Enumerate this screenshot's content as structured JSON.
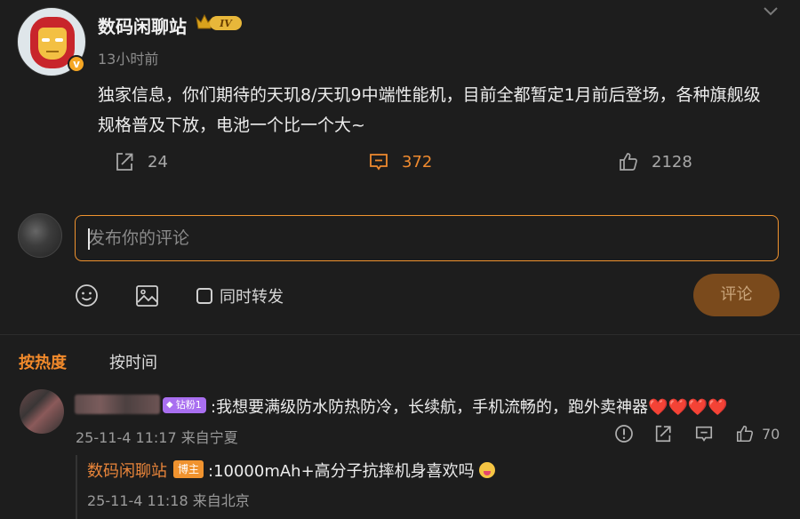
{
  "post": {
    "username": "数码闲聊站",
    "level_badge": "IV",
    "time": "13小时前",
    "text": "独家信息，你们期待的天玑8/天玑9中端性能机，目前全都暂定1月前后登场，各种旗舰级规格普及下放，电池一个比一个大~",
    "share_count": "24",
    "comment_count": "372",
    "like_count": "2128",
    "verify_mark": "v"
  },
  "composer": {
    "placeholder": "发布你的评论",
    "repost_label": "同时转发",
    "submit_label": "评论"
  },
  "sort": {
    "hot": "按热度",
    "time": "按时间"
  },
  "comments": [
    {
      "badge": "钻粉1",
      "text": ":我想要满级防水防热防冷，长续航，手机流畅的，跑外卖神器",
      "hearts": "❤️❤️❤️❤️",
      "meta": "25-11-4 11:17 来自宁夏",
      "likes": "70"
    }
  ],
  "reply": {
    "name": "数码闲聊站",
    "badge": "博主",
    "text": ":10000mAh+高分子抗摔机身喜欢吗",
    "meta": "25-11-4 11:18 来自北京"
  },
  "colors": {
    "accent": "#f0932f",
    "background": "#1d1d1d",
    "heart": "#e8372f",
    "fan_badge": "#a96ff0"
  },
  "icons": [
    "chevron-down-icon",
    "share-icon",
    "comment-icon",
    "like-icon",
    "emoji-icon",
    "image-icon",
    "more-icon",
    "reply-icon"
  ]
}
